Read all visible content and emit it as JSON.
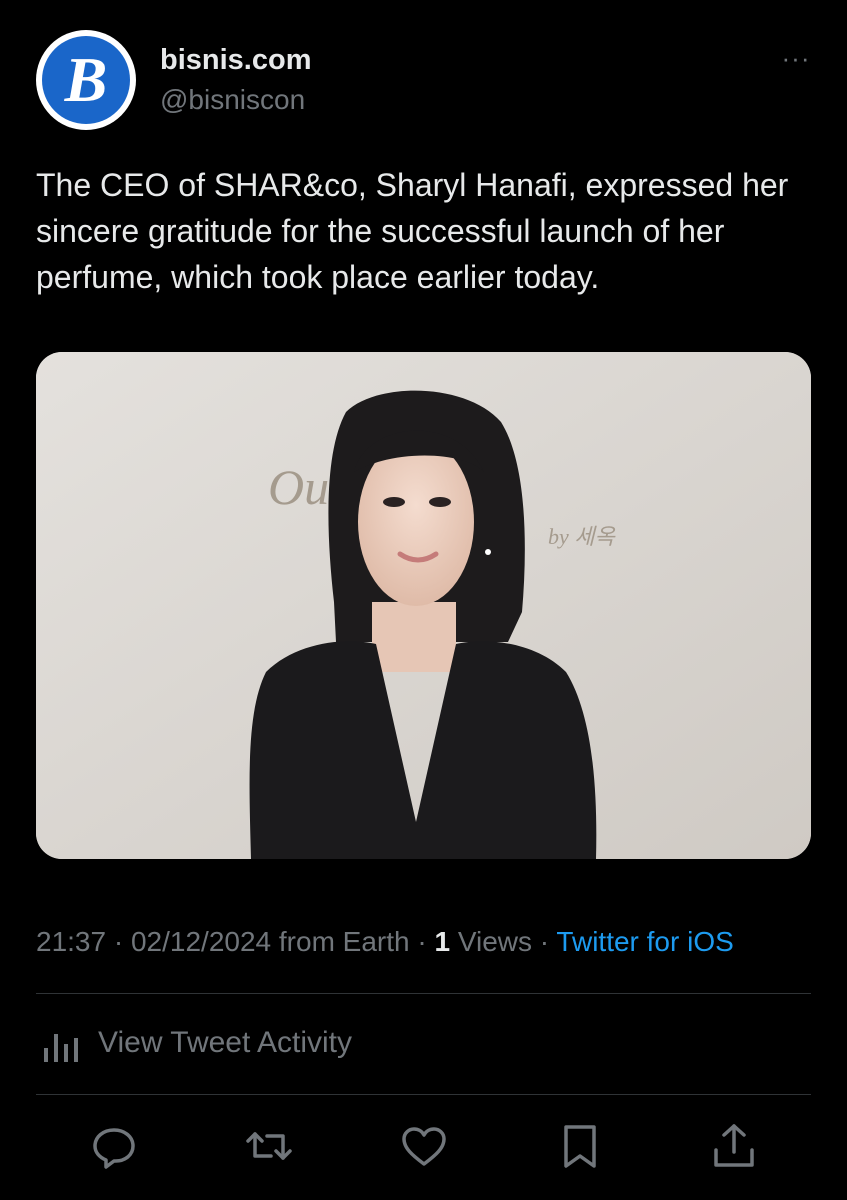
{
  "account": {
    "display_name": "bisnis.com",
    "handle": "@bisniscon",
    "avatar_letter": "B",
    "avatar_color": "#1a66c9"
  },
  "header": {
    "more_label": "···"
  },
  "tweet": {
    "text": "The CEO of SHAR&co, Sharyl Hanafi, expressed her sincere gratitude for the successful launch of her perfume, which took place earlier today."
  },
  "media": {
    "wall_sign": "Ou      telier",
    "wall_sign_sub": "by 세옥"
  },
  "meta": {
    "time": "21:37",
    "separator1": " · ",
    "date": "02/12/2024",
    "location": " from Earth",
    "separator2": " · ",
    "views_count": "1",
    "views_label": " Views",
    "separator3": " · ",
    "source": "Twitter for iOS"
  },
  "activity": {
    "label": "View Tweet Activity",
    "icon": "analytics-icon"
  },
  "actions": [
    {
      "name": "reply-icon"
    },
    {
      "name": "retweet-icon"
    },
    {
      "name": "like-icon"
    },
    {
      "name": "bookmark-icon"
    },
    {
      "name": "share-icon"
    }
  ],
  "colors": {
    "background": "#000000",
    "primary_text": "#e7e9ea",
    "secondary_text": "#71767b",
    "link": "#1d9bf0",
    "divider": "#2f3336"
  }
}
